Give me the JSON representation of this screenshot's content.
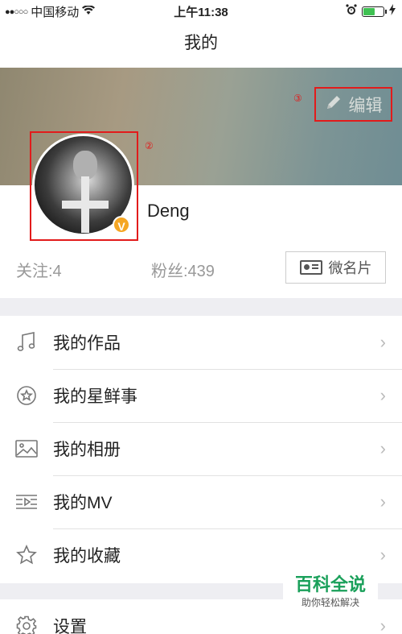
{
  "status_bar": {
    "carrier": "中国移动",
    "time": "上午11:38",
    "battery_level": 0.55,
    "colors": {
      "battery": "#3fc152"
    }
  },
  "nav": {
    "title": "我的"
  },
  "profile": {
    "edit_label": "编辑",
    "edit_marker": "③",
    "avatar_marker": "②",
    "verified_badge": "V",
    "username": "Deng"
  },
  "stats": {
    "follow": "关注:4",
    "fans": "粉丝:439",
    "card_label": "微名片"
  },
  "menu": [
    {
      "icon": "music-note-icon",
      "label": "我的作品"
    },
    {
      "icon": "star-circle-icon",
      "label": "我的星鲜事"
    },
    {
      "icon": "photo-album-icon",
      "label": "我的相册"
    },
    {
      "icon": "mv-icon",
      "label": "我的MV"
    },
    {
      "icon": "star-outline-icon",
      "label": "我的收藏"
    }
  ],
  "settings": {
    "icon": "gear-icon",
    "label": "设置"
  },
  "watermark": {
    "title": "百科全说",
    "subtitle": "助你轻松解决"
  },
  "colors": {
    "accent_red": "#e21b1b",
    "badge": "#f5a623",
    "watermark_green": "#1aa05a"
  }
}
